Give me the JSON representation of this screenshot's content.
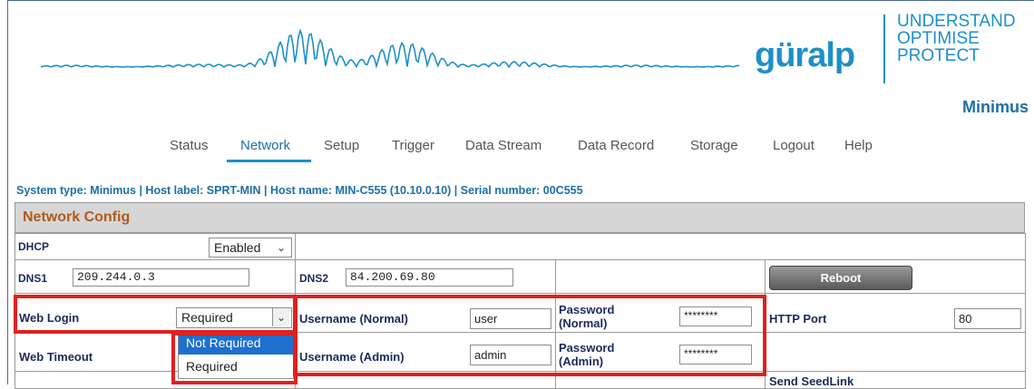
{
  "brand": {
    "logo_text": "güralp",
    "tagline": [
      "UNDERSTAND",
      "OPTIMISE",
      "PROTECT"
    ],
    "product": "Minimus",
    "accent_color": "#1d8fc9"
  },
  "nav": {
    "items": [
      "Status",
      "Network",
      "Setup",
      "Trigger",
      "Data Stream",
      "Data Record",
      "Storage",
      "Logout",
      "Help"
    ],
    "active": "Network"
  },
  "system_line": "System type: Minimus | Host label: SPRT-MIN | Host name: MIN-C555 (10.10.0.10) | Serial number: 00C555",
  "section_title": "Network Config",
  "fields": {
    "dhcp": {
      "label": "DHCP",
      "value": "Enabled"
    },
    "dns1": {
      "label": "DNS1",
      "value": "209.244.0.3"
    },
    "dns2": {
      "label": "DNS2",
      "value": "84.200.69.80"
    },
    "reboot_label": "Reboot",
    "web_login": {
      "label": "Web Login",
      "value": "Required",
      "options": [
        "Not Required",
        "Required"
      ],
      "highlighted": "Not Required"
    },
    "username_normal": {
      "label": "Username (Normal)",
      "value": "user"
    },
    "password_normal": {
      "label_line1": "Password",
      "label_line2": "(Normal)",
      "value": "********"
    },
    "http_port": {
      "label": "HTTP Port",
      "value": "80"
    },
    "web_timeout": {
      "label": "Web Timeout"
    },
    "username_admin": {
      "label": "Username (Admin)",
      "value": "admin"
    },
    "password_admin": {
      "label_line1": "Password",
      "label_line2": "(Admin)",
      "value": "********"
    },
    "send_seedlink": {
      "label": "Send SeedLink"
    }
  },
  "highlight_color": "#e02020"
}
